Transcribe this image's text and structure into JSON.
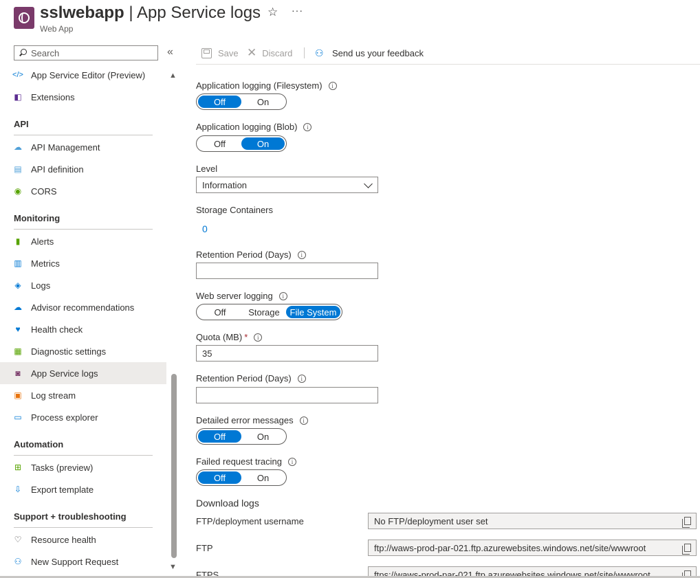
{
  "header": {
    "title_bold": "sslwebapp",
    "title_rest": " | App Service logs",
    "subtitle": "Web App",
    "star_icon": "☆",
    "more_icon": "···"
  },
  "sidebar": {
    "search_placeholder": "Search",
    "collapse_icon": "«",
    "items": [
      {
        "label": "App Service Editor (Preview)",
        "icon": "code-icon",
        "glyph": "</>",
        "color": "#0078d4"
      },
      {
        "label": "Extensions",
        "icon": "extensions-icon",
        "glyph": "◧",
        "color": "#5c2d91"
      },
      {
        "label": "API Management",
        "icon": "api-management-icon",
        "glyph": "☁",
        "color": "#50a0d8"
      },
      {
        "label": "API definition",
        "icon": "api-definition-icon",
        "glyph": "▤",
        "color": "#50a0d8"
      },
      {
        "label": "CORS",
        "icon": "cors-icon",
        "glyph": "◉",
        "color": "#57a300"
      },
      {
        "label": "Alerts",
        "icon": "alerts-icon",
        "glyph": "▮",
        "color": "#57a300"
      },
      {
        "label": "Metrics",
        "icon": "metrics-icon",
        "glyph": "▥",
        "color": "#0078d4"
      },
      {
        "label": "Logs",
        "icon": "logs-icon",
        "glyph": "◈",
        "color": "#0078d4"
      },
      {
        "label": "Advisor recommendations",
        "icon": "advisor-icon",
        "glyph": "☁",
        "color": "#0078d4"
      },
      {
        "label": "Health check",
        "icon": "health-check-icon",
        "glyph": "♥",
        "color": "#0078d4"
      },
      {
        "label": "Diagnostic settings",
        "icon": "diagnostic-settings-icon",
        "glyph": "▦",
        "color": "#57a300"
      },
      {
        "label": "App Service logs",
        "icon": "app-service-logs-icon",
        "glyph": "◙",
        "color": "#7a3a6a"
      },
      {
        "label": "Log stream",
        "icon": "log-stream-icon",
        "glyph": "▣",
        "color": "#e8730c"
      },
      {
        "label": "Process explorer",
        "icon": "process-explorer-icon",
        "glyph": "▭",
        "color": "#0078d4"
      },
      {
        "label": "Tasks (preview)",
        "icon": "tasks-icon",
        "glyph": "⊞",
        "color": "#57a300"
      },
      {
        "label": "Export template",
        "icon": "export-template-icon",
        "glyph": "⇩",
        "color": "#0078d4"
      },
      {
        "label": "Resource health",
        "icon": "resource-health-icon",
        "glyph": "♡",
        "color": "#323130"
      },
      {
        "label": "New Support Request",
        "icon": "support-request-icon",
        "glyph": "⚇",
        "color": "#0078d4"
      }
    ],
    "sections": [
      "API",
      "Monitoring",
      "Automation",
      "Support + troubleshooting"
    ]
  },
  "toolbar": {
    "save": "Save",
    "discard": "Discard",
    "feedback": "Send us your feedback"
  },
  "form": {
    "app_logging_fs": {
      "label": "Application logging (Filesystem)",
      "options": [
        "Off",
        "On"
      ],
      "selected": "Off"
    },
    "app_logging_blob": {
      "label": "Application logging (Blob)",
      "options": [
        "Off",
        "On"
      ],
      "selected": "On"
    },
    "level": {
      "label": "Level",
      "value": "Information"
    },
    "storage_containers": {
      "label": "Storage Containers",
      "value": "0"
    },
    "retention_1": {
      "label": "Retention Period (Days)",
      "value": ""
    },
    "web_server_logging": {
      "label": "Web server logging",
      "options": [
        "Off",
        "Storage",
        "File System"
      ],
      "selected": "File System"
    },
    "quota": {
      "label": "Quota (MB)",
      "required": "*",
      "value": "35"
    },
    "retention_2": {
      "label": "Retention Period (Days)",
      "value": ""
    },
    "detailed_errors": {
      "label": "Detailed error messages",
      "options": [
        "Off",
        "On"
      ],
      "selected": "Off"
    },
    "failed_request": {
      "label": "Failed request tracing",
      "options": [
        "Off",
        "On"
      ],
      "selected": "Off"
    },
    "download_heading": "Download logs",
    "ftp_username": {
      "label": "FTP/deployment username",
      "value": "No FTP/deployment user set"
    },
    "ftp": {
      "label": "FTP",
      "value": "ftp://waws-prod-par-021.ftp.azurewebsites.windows.net/site/wwwroot"
    },
    "ftps": {
      "label": "FTPS",
      "value": "ftps://waws-prod-par-021.ftp.azurewebsites.windows.net/site/wwwroot"
    }
  }
}
